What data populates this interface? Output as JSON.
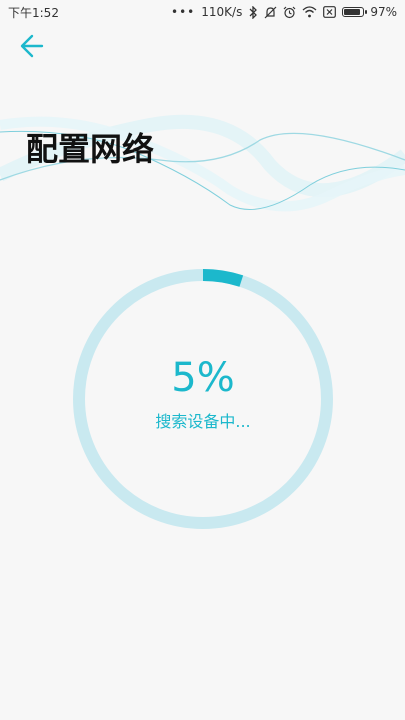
{
  "status_bar": {
    "time": "下午1:52",
    "dots": "•••",
    "net_speed": "110K/s",
    "battery": "97%",
    "battery_level": 0.97,
    "icons": [
      "bluetooth-icon",
      "mute-icon",
      "alarm-icon",
      "wifi-icon",
      "close-box-icon",
      "battery-icon"
    ]
  },
  "header": {
    "back_icon": "arrow-left-icon",
    "title": "配置网络"
  },
  "progress": {
    "percent_text": "5%",
    "value": 0.05,
    "status": "搜索设备中..."
  },
  "colors": {
    "accent": "#1cb8cc",
    "ring_track": "#c9e9f0",
    "background": "#f7f7f7"
  }
}
